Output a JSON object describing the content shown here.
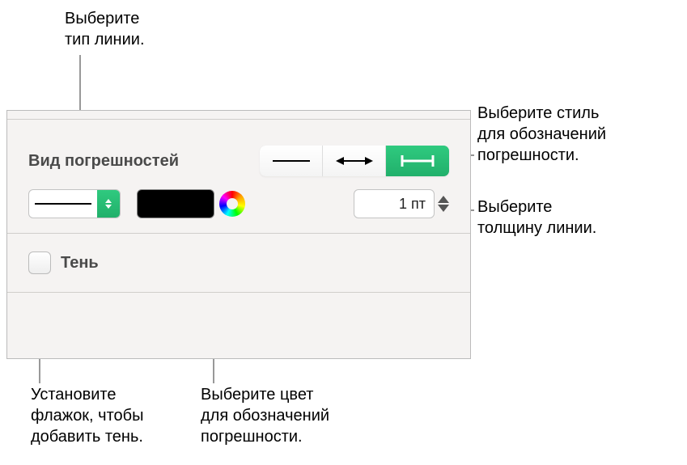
{
  "callouts": {
    "line_type": "Выберите\nтип линии.",
    "style": "Выберите стиль\nдля обозначений\nпогрешности.",
    "shadow": "Установите\nфлажок, чтобы\nдобавить тень.",
    "color": "Выберите цвет\nдля обозначений\nпогрешности.",
    "thickness": "Выберите\nтолщину линии."
  },
  "panel": {
    "title": "Вид погрешностей",
    "segments": [
      "plain-line",
      "end-caps",
      "error-bar"
    ],
    "selected_segment_index": 2,
    "line_type_selected": "solid",
    "color_value": "#000000",
    "thickness_value": "1 пт",
    "shadow_label": "Тень",
    "shadow_checked": false
  }
}
